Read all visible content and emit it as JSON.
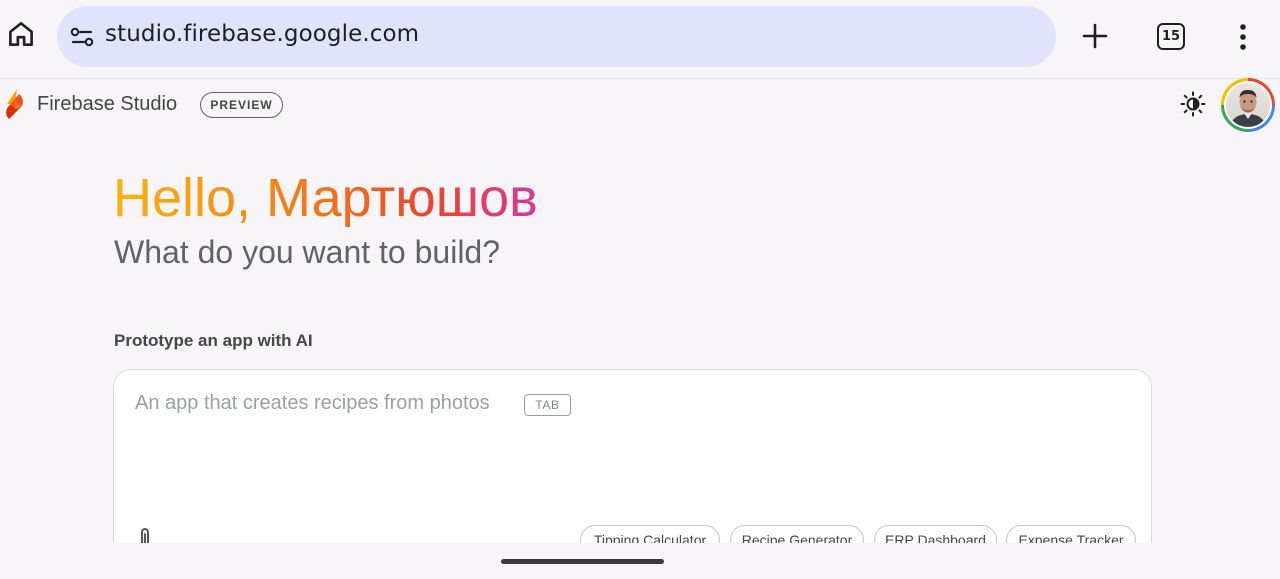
{
  "browser": {
    "url": "studio.firebase.google.com",
    "tab_count": "15",
    "icons": [
      "home-icon",
      "site-info-icon",
      "plus-icon",
      "tab-switcher-icon",
      "more-vert-icon"
    ]
  },
  "header": {
    "brand": "Firebase Studio",
    "badge": "PREVIEW",
    "icons": [
      "firebase-logo",
      "theme-toggle-icon",
      "avatar"
    ]
  },
  "main": {
    "greeting": "Hello, Мартюшов",
    "subtitle": "What do you want to build?",
    "section_label": "Prototype an app with AI",
    "prompt": {
      "value": "",
      "placeholder": "An app that creates recipes from photos",
      "tab_hint": "TAB"
    },
    "suggestions": [
      "Tipping Calculator",
      "Recipe Generator",
      "ERP Dashboard",
      "Expense Tracker"
    ]
  },
  "colors": {
    "url_bar": "#e0e3fb",
    "greeting_gradient": [
      "#f8b40f",
      "#f36a1a",
      "#d7389c"
    ],
    "background": "#f7f5f8"
  }
}
